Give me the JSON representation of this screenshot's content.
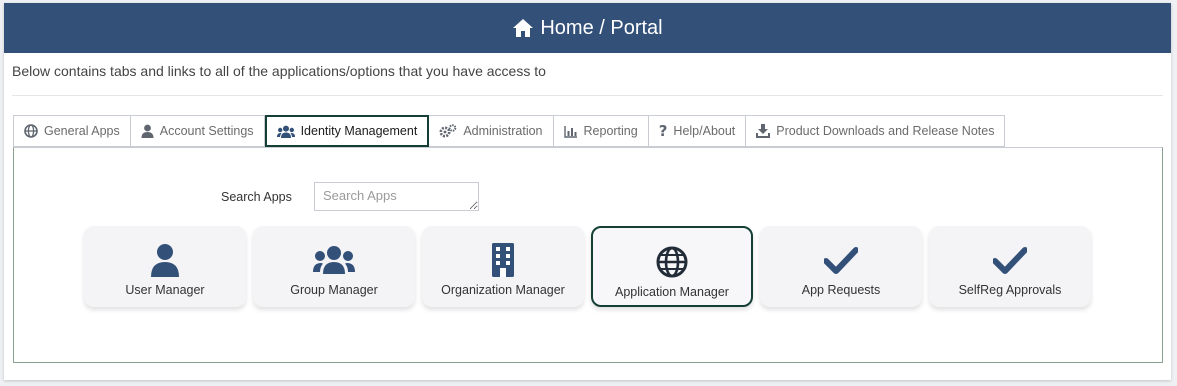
{
  "header": {
    "title": "Home / Portal",
    "icon": "home-icon"
  },
  "intro": "Below contains tabs and links to all of the applications/options that you have access to",
  "tabs": [
    {
      "label": "General Apps",
      "icon": "globe-icon"
    },
    {
      "label": "Account Settings",
      "icon": "user-icon"
    },
    {
      "label": "Identity Management",
      "icon": "users-icon",
      "active": true
    },
    {
      "label": "Administration",
      "icon": "gears-icon"
    },
    {
      "label": "Reporting",
      "icon": "chart-icon"
    },
    {
      "label": "Help/About",
      "icon": "question-icon"
    },
    {
      "label": "Product Downloads and Release Notes",
      "icon": "download-icon"
    }
  ],
  "search": {
    "label": "Search Apps",
    "placeholder": "Search Apps"
  },
  "apps": [
    {
      "label": "User Manager",
      "icon": "user-icon"
    },
    {
      "label": "Group Manager",
      "icon": "users-icon"
    },
    {
      "label": "Organization Manager",
      "icon": "building-icon"
    },
    {
      "label": "Application Manager",
      "icon": "globe-icon",
      "active": true
    },
    {
      "label": "App Requests",
      "icon": "check-icon"
    },
    {
      "label": "SelfReg Approvals",
      "icon": "check-icon"
    }
  ],
  "colors": {
    "header_bg": "#335079",
    "accent_border": "#153f35",
    "icon_blue": "#335079",
    "tab_icon": "#5f6670"
  }
}
